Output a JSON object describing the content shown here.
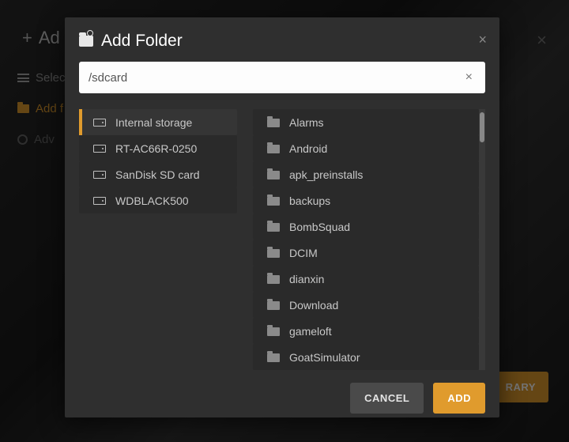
{
  "background": {
    "add_label": "Ad",
    "select_label": "Selec",
    "folder_label": "Add f",
    "advanced_label": "Adv",
    "library_button": "RARY"
  },
  "modal": {
    "title": "Add Folder",
    "path_value": "/sdcard",
    "cancel_label": "CANCEL",
    "add_label": "ADD",
    "left_items": [
      {
        "label": "Internal storage",
        "selected": true
      },
      {
        "label": "RT-AC66R-0250",
        "selected": false
      },
      {
        "label": "SanDisk SD card",
        "selected": false
      },
      {
        "label": "WDBLACK500",
        "selected": false
      }
    ],
    "right_items": [
      {
        "label": "Alarms"
      },
      {
        "label": "Android"
      },
      {
        "label": "apk_preinstalls"
      },
      {
        "label": "backups"
      },
      {
        "label": "BombSquad"
      },
      {
        "label": "DCIM"
      },
      {
        "label": "dianxin"
      },
      {
        "label": "Download"
      },
      {
        "label": "gameloft"
      },
      {
        "label": "GoatSimulator"
      }
    ]
  }
}
